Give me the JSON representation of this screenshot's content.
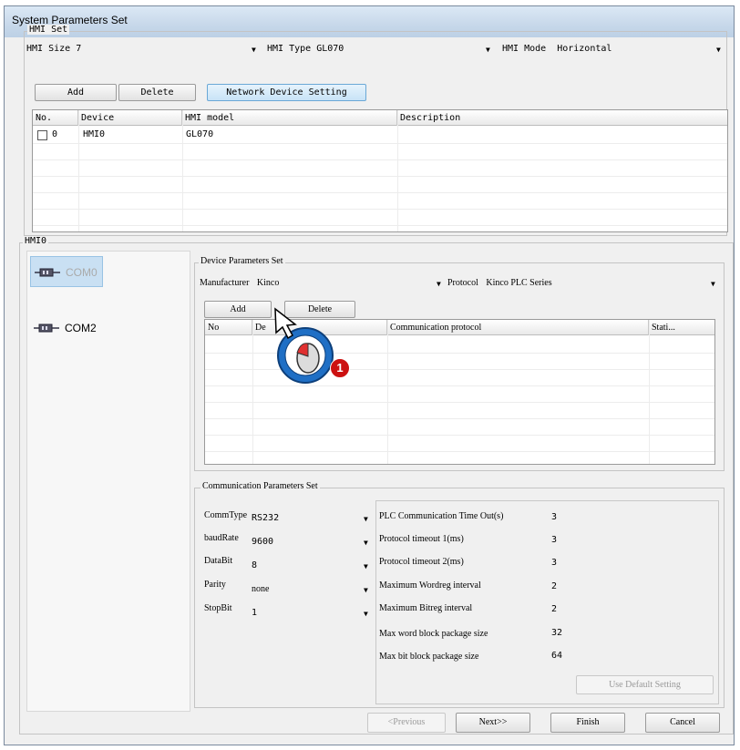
{
  "window": {
    "title": "System Parameters Set"
  },
  "hmi_set": {
    "group_label": "HMI Set",
    "size_label": "HMI Size",
    "size_value": "7",
    "type_label": "HMI Type",
    "type_value": "GL070",
    "mode_label": "HMI Mode",
    "mode_value": "Horizontal",
    "buttons": {
      "add": "Add",
      "delete": "Delete",
      "network": "Network Device Setting"
    },
    "table": {
      "columns": [
        "No.",
        "Device",
        "HMI model",
        "Description"
      ],
      "rows": [
        {
          "no": "0",
          "device": "HMI0",
          "model": "GL070",
          "description": ""
        }
      ]
    }
  },
  "hmi0": {
    "group_label": "HMI0",
    "ports": [
      {
        "label": "COM0",
        "selected": true
      },
      {
        "label": "COM2",
        "selected": false
      }
    ]
  },
  "device_params": {
    "group_label": "Device Parameters Set",
    "manufacturer_label": "Manufacturer",
    "manufacturer_value": "Kinco",
    "protocol_label": "Protocol",
    "protocol_value": "Kinco PLC Series",
    "buttons": {
      "add": "Add",
      "delete": "Delete"
    },
    "columns": [
      "No",
      "De",
      "Communication protocol",
      "Stati..."
    ]
  },
  "comm_params": {
    "group_label": "Communication Parameters Set",
    "fields": [
      {
        "label": "CommType",
        "value": "RS232"
      },
      {
        "label": "baudRate",
        "value": "9600"
      },
      {
        "label": "DataBit",
        "value": "8"
      },
      {
        "label": "Parity",
        "value": "none"
      },
      {
        "label": "StopBit",
        "value": "1"
      }
    ],
    "timeouts": [
      {
        "label": "PLC Communication Time Out(s)",
        "value": "3"
      },
      {
        "label": "Protocol timeout 1(ms)",
        "value": "3"
      },
      {
        "label": "Protocol timeout 2(ms)",
        "value": "3"
      },
      {
        "label": "Maximum Wordreg interval",
        "value": "2"
      },
      {
        "label": "Maximum Bitreg interval",
        "value": "2"
      },
      {
        "label": "Max word block package size",
        "value": "32"
      },
      {
        "label": "Max bit block package size",
        "value": "64"
      }
    ],
    "default_button": "Use Default Setting"
  },
  "footer": {
    "previous": "<Previous",
    "next": "Next>>",
    "finish": "Finish",
    "cancel": "Cancel"
  },
  "annotation": {
    "step": "1"
  },
  "colors": {
    "accent": "#1f6fc5",
    "step_badge": "#cc1111"
  }
}
